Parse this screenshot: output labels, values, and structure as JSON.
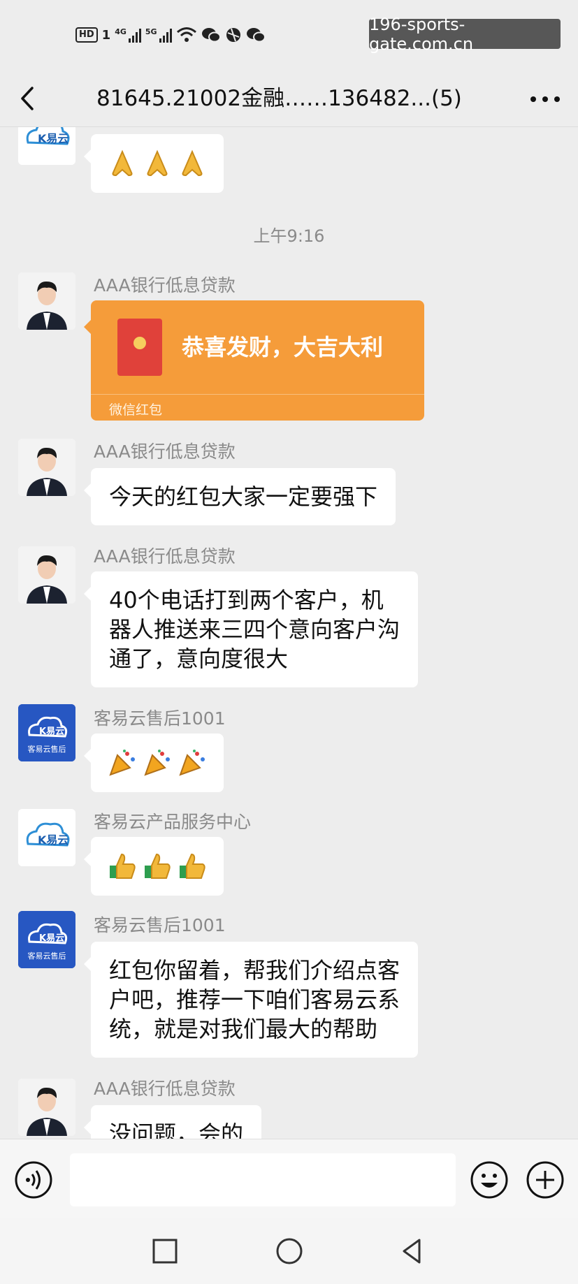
{
  "status_bar": {
    "hd": "HD",
    "sim": "1",
    "net1": "4G",
    "net2": "5G",
    "watermark": "196-sports-gate.com.cn"
  },
  "header": {
    "title": "81645.21002金融……136482...(5)",
    "back_icon": "chevron-left-icon",
    "more_icon": "more-dots-icon"
  },
  "messages": {
    "first": {
      "emoji_icons": [
        "folded-hands-icon",
        "folded-hands-icon",
        "folded-hands-icon"
      ]
    },
    "time_label": "上午9:16",
    "m1": {
      "sender": "AAA银行低息贷款",
      "redpacket_text": "恭喜发财，大吉大利",
      "redpacket_label": "微信红包"
    },
    "m2": {
      "sender": "AAA银行低息贷款",
      "line1": "今天的红包大家一定要强下"
    },
    "m3": {
      "sender": "AAA银行低息贷款",
      "line1": "40个电话打到两个客户，机",
      "line2": "器人推送来三四个意向客户沟",
      "line3": "通了，意向度很大"
    },
    "m4": {
      "sender": "客易云售后1001",
      "emoji_icons": [
        "party-popper-icon",
        "party-popper-icon",
        "party-popper-icon"
      ]
    },
    "m5": {
      "sender": "客易云产品服务中心",
      "emoji_icons": [
        "thumbs-up-icon",
        "thumbs-up-icon",
        "thumbs-up-icon"
      ]
    },
    "m6": {
      "sender": "客易云售后1001",
      "line1": "红包你留着，帮我们介绍点客",
      "line2": "户吧，推荐一下咱们客易云系",
      "line3": "统，就是对我们最大的帮助"
    },
    "m7": {
      "sender": "AAA银行低息贷款",
      "line1": "没问题，会的"
    }
  },
  "avatars": {
    "brand_label": "K易云",
    "service_label": "客易云售后"
  },
  "input_bar": {
    "placeholder": ""
  },
  "colors": {
    "background": "#ededed",
    "redpacket": "#f59c3a",
    "bubble": "#ffffff"
  }
}
